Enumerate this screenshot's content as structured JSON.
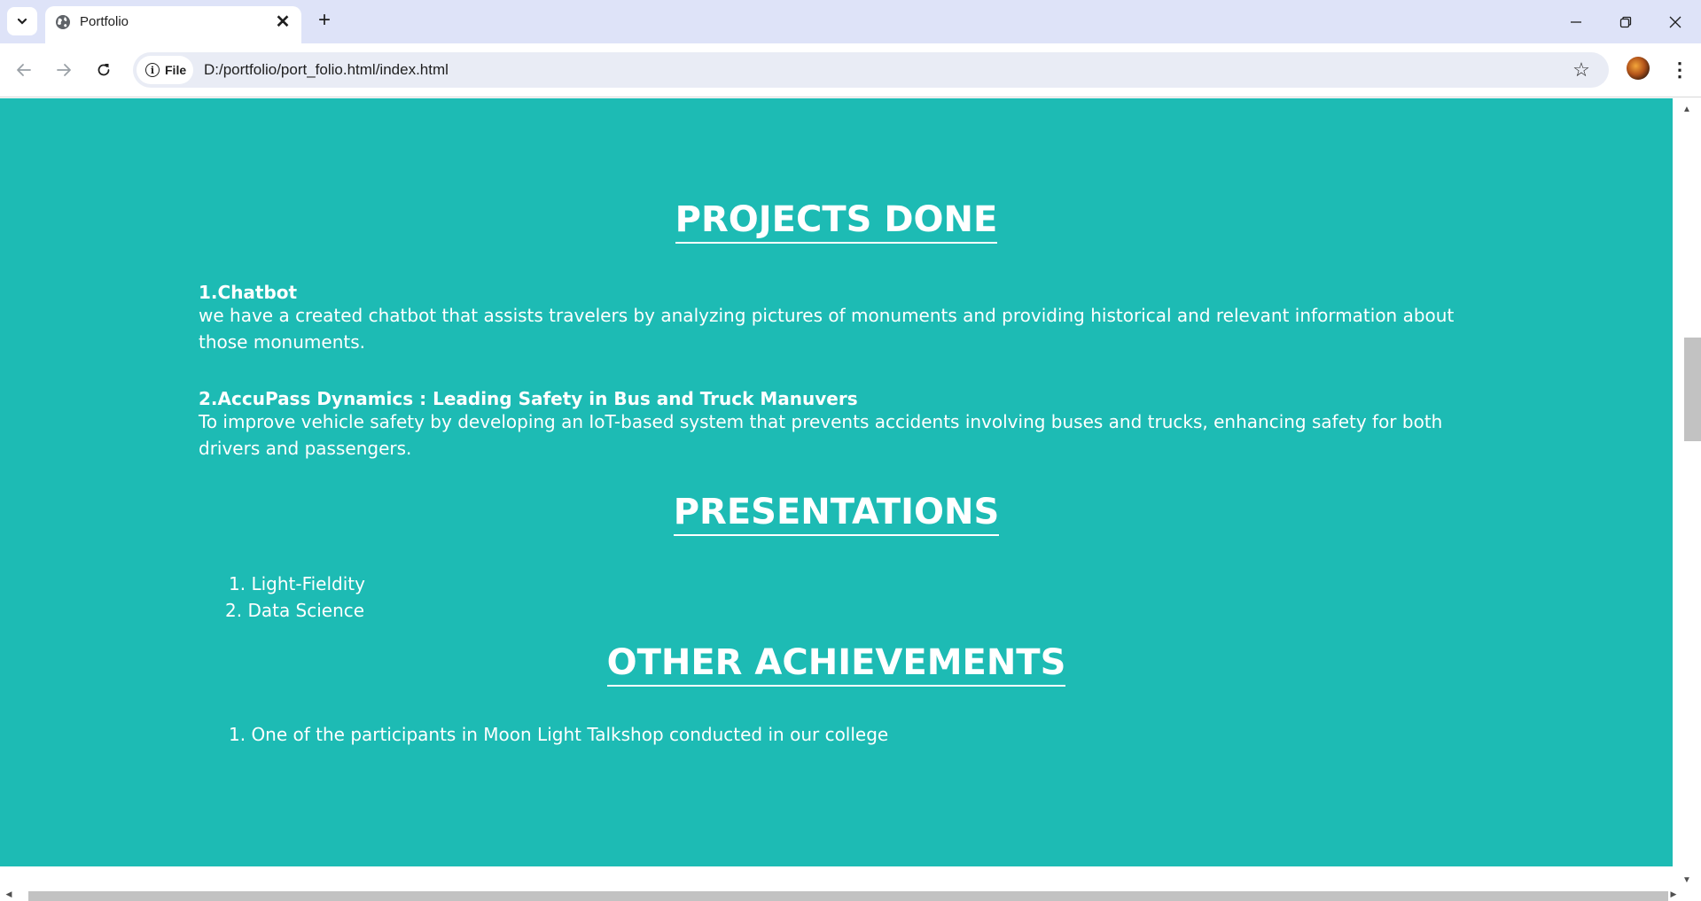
{
  "browser": {
    "tab": {
      "title": "Portfolio",
      "close": "✕"
    },
    "new_tab": "+",
    "window_controls": {
      "minimize": "—",
      "restore": "❐",
      "close": "✕"
    },
    "nav": {
      "back": "←",
      "forward": "→",
      "reload": "↻"
    },
    "omnibox": {
      "chip_label": "File",
      "url": "D:/portfolio/port_folio.html/index.html"
    },
    "bookmark_star": "☆",
    "menu": "⋮",
    "icons": [
      "tab-search-icon",
      "globe-icon",
      "info-icon",
      "star-icon",
      "avatar",
      "kebab-menu-icon"
    ]
  },
  "page": {
    "background_color": "#1dbbb4",
    "projects": {
      "heading": "PROJECTS DONE",
      "items": [
        {
          "title": "1.Chatbot",
          "description": "we have a created chatbot that assists travelers by analyzing pictures of monuments and providing historical and relevant information about those monuments."
        },
        {
          "title": "2.AccuPass Dynamics : Leading Safety in Bus and Truck Manuvers",
          "description": "To improve vehicle safety by developing an IoT-based system that prevents accidents involving buses and trucks, enhancing safety for both drivers and passengers."
        }
      ]
    },
    "presentations": {
      "heading": "PRESENTATIONS",
      "items": [
        "1.  Light-Fieldity",
        "2. Data Science"
      ]
    },
    "achievements": {
      "heading": "OTHER ACHIEVEMENTS",
      "items": [
        "1. One of the participants in Moon Light Talkshop conducted in our college"
      ]
    }
  }
}
